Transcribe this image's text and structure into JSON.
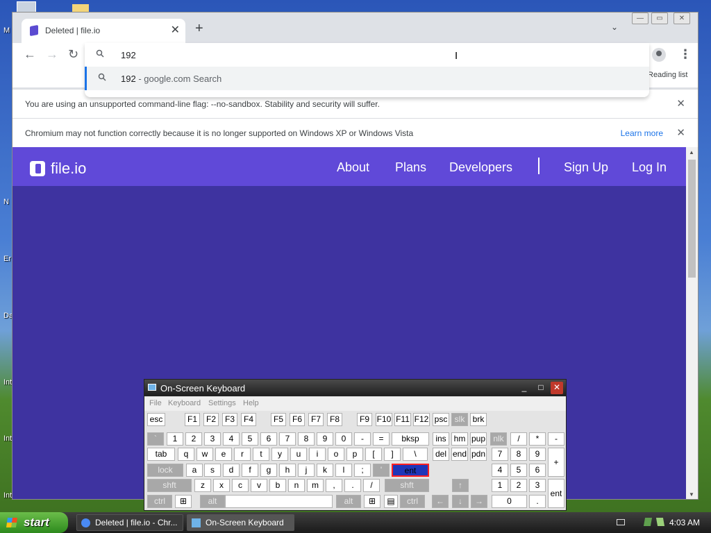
{
  "desktop": {
    "labels": [
      "M",
      "N",
      "Er",
      "Da",
      "Int",
      "Int",
      "Int"
    ]
  },
  "chrome": {
    "tab": {
      "title": "Deleted | file.io",
      "close": "✕"
    },
    "new_tab": "+",
    "tab_menu": "⌄",
    "window_controls": {
      "minimize": "—",
      "restore": "▭",
      "close": "✕"
    },
    "nav": {
      "back": "←",
      "forward": "→",
      "reload": "↻",
      "menu": "⋮"
    },
    "omnibox": {
      "value": "192",
      "suggestion_main": "192",
      "suggestion_rest": " - google.com Search",
      "cursor": "I"
    },
    "reading_list": "Reading list",
    "infobars": [
      {
        "text": "You are using an unsupported command-line flag: --no-sandbox. Stability and security will suffer.",
        "close": "✕"
      },
      {
        "text": "Chromium may not function correctly because it is no longer supported on Windows XP or Windows Vista",
        "link": "Learn more",
        "close": "✕"
      }
    ]
  },
  "page": {
    "brand": "file.io",
    "nav": {
      "about": "About",
      "plans": "Plans",
      "developers": "Developers",
      "signup": "Sign Up",
      "login": "Log In"
    },
    "scroll": {
      "up": "▲",
      "down": "▼"
    }
  },
  "osk": {
    "title": "On-Screen Keyboard",
    "controls": {
      "min": "_",
      "max": "□",
      "close": "✕"
    },
    "menu": [
      "File",
      "Keyboard",
      "Settings",
      "Help"
    ],
    "keys": [
      "esc",
      "F1",
      "F2",
      "F3",
      "F4",
      "F5",
      "F6",
      "F7",
      "F8",
      "F9",
      "F10",
      "F11",
      "F12",
      "psc",
      "slk",
      "brk",
      "`",
      "1",
      "2",
      "3",
      "4",
      "5",
      "6",
      "7",
      "8",
      "9",
      "0",
      "-",
      "=",
      "bksp",
      "ins",
      "hm",
      "pup",
      "nlk",
      "/",
      "*",
      "-",
      "tab",
      "q",
      "w",
      "e",
      "r",
      "t",
      "y",
      "u",
      "i",
      "o",
      "p",
      "[",
      "]",
      "\\",
      "del",
      "end",
      "pdn",
      "7",
      "8",
      "9",
      "+",
      "lock",
      "a",
      "s",
      "d",
      "f",
      "g",
      "h",
      "j",
      "k",
      "l",
      ";",
      "'",
      "ent",
      "4",
      "5",
      "6",
      "shft",
      "z",
      "x",
      "c",
      "v",
      "b",
      "n",
      "m",
      ",",
      ".",
      "/",
      "shft",
      "↑",
      "1",
      "2",
      "3",
      "ent",
      "ctrl",
      "⊞",
      "alt",
      "",
      "alt",
      "⊞",
      "▤",
      "ctrl",
      "←",
      "↓",
      "→",
      "0",
      "."
    ]
  },
  "taskbar": {
    "start": "start",
    "tasks": [
      "Deleted | file.io - Chr...",
      "On-Screen Keyboard"
    ],
    "clock": "4:03 AM"
  }
}
